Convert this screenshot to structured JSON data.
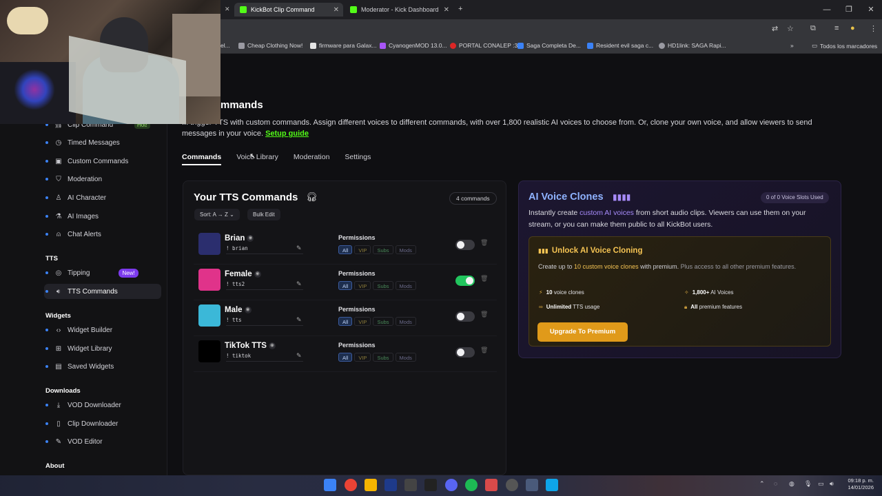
{
  "browser": {
    "tabs": [
      {
        "label": "KickBot Clip Command",
        "close": "✕"
      },
      {
        "label": "Moderator - Kick Dashboard",
        "close": "✕"
      }
    ],
    "new_tab": "+",
    "prev_tab_close": "✕",
    "window_controls": {
      "minimize": "—",
      "maximize": "❐",
      "close": "✕"
    },
    "bookmarks": [
      {
        "label": "Cheap Clothing Now!",
        "color": "#9a9aa2"
      },
      {
        "label": "firmware para Galax...",
        "color": "#e5e5e5"
      },
      {
        "label": "CyanogenMOD 13.0...",
        "color": "#a855f7"
      },
      {
        "label": "PORTAL CONALEP :3",
        "color": "#dc2626"
      },
      {
        "label": "Saga Completa De...",
        "color": "#3b82f6"
      },
      {
        "label": "Resident evil saga c...",
        "color": "#3b82f6"
      },
      {
        "label": "HD1link: SAGA Rapi...",
        "color": "#9a9aa2"
      }
    ],
    "bookmark_prefix": "el...",
    "all_bookmarks": "Todos los marcadores"
  },
  "sidebar": {
    "items_top": [
      {
        "label": "Clip Command",
        "icon": "link-icon"
      },
      {
        "label": "Timed Messages",
        "icon": "clock-icon"
      },
      {
        "label": "Custom Commands",
        "icon": "terminal-icon"
      },
      {
        "label": "Moderation",
        "icon": "shield-icon"
      },
      {
        "label": "AI Character",
        "icon": "person-icon"
      },
      {
        "label": "AI Images",
        "icon": "flask-icon"
      },
      {
        "label": "Chat Alerts",
        "icon": "bell-icon"
      }
    ],
    "hot_badge": "Hot!",
    "tts_heading": "TTS",
    "tipping": {
      "label": "Tipping",
      "badge": "New!"
    },
    "tts_commands": "TTS Commands",
    "widgets_heading": "Widgets",
    "widgets": [
      "Widget Builder",
      "Widget Library",
      "Saved Widgets"
    ],
    "downloads_heading": "Downloads",
    "downloads": [
      "VOD Downloader",
      "Clip Downloader",
      "VOD Editor"
    ],
    "about_heading": "About"
  },
  "main": {
    "title": "mmands",
    "description_prefix": "... trigger TTS with custom commands. Assign different voices to different commands, with over 1,800 realistic AI voices to choose from. Or, clone your own voice, and allow viewers to send messages in your voice.",
    "setup_guide": "Setup guide",
    "tabs": [
      "Commands",
      "Voice Library",
      "Moderation",
      "Settings"
    ],
    "active_tab": "Commands"
  },
  "commands": {
    "title": "Your TTS Commands",
    "count": "4 commands",
    "sort_label": "Sort: A → Z",
    "bulk_edit": "Bulk Edit",
    "perm_label": "Permissions",
    "chips": [
      "All",
      "VIP",
      "Subs",
      "Mods"
    ],
    "rows": [
      {
        "name": "Brian",
        "trigger": "! brian",
        "enabled": false,
        "avatar_color": "#2b2e6e"
      },
      {
        "name": "Female",
        "trigger": "! tts2",
        "enabled": true,
        "avatar_color": "#e0338a"
      },
      {
        "name": "Male",
        "trigger": "! tts",
        "enabled": false,
        "avatar_color": "#3bb8d8"
      },
      {
        "name": "TikTok TTS",
        "trigger": "! tiktok",
        "enabled": false,
        "avatar_color": "#000000"
      }
    ]
  },
  "clones": {
    "title": "AI Voice Clones",
    "slots": "0 of 0 Voice Slots Used",
    "desc_1": "Instantly create ",
    "desc_hl": "custom AI voices",
    "desc_2": " from short audio clips. Viewers can use them on your stream, or you can make them public to all KickBot users.",
    "unlock_title": "Unlock AI Voice Cloning",
    "unlock_1": "Create up to ",
    "unlock_hl": "10 custom voice clones",
    "unlock_2": " with premium.",
    "unlock_3": " Plus access to all other premium features.",
    "features": [
      {
        "bold": "10",
        "rest": " voice clones"
      },
      {
        "bold": "1,800+",
        "rest": " AI Voices"
      },
      {
        "bold": "Unlimited",
        "rest": " TTS usage"
      },
      {
        "bold": "All",
        "rest": " premium features"
      }
    ],
    "upgrade": "Upgrade To Premium"
  },
  "taskbar": {
    "time": "09:18 p. m.",
    "date": "14/01/2026"
  }
}
